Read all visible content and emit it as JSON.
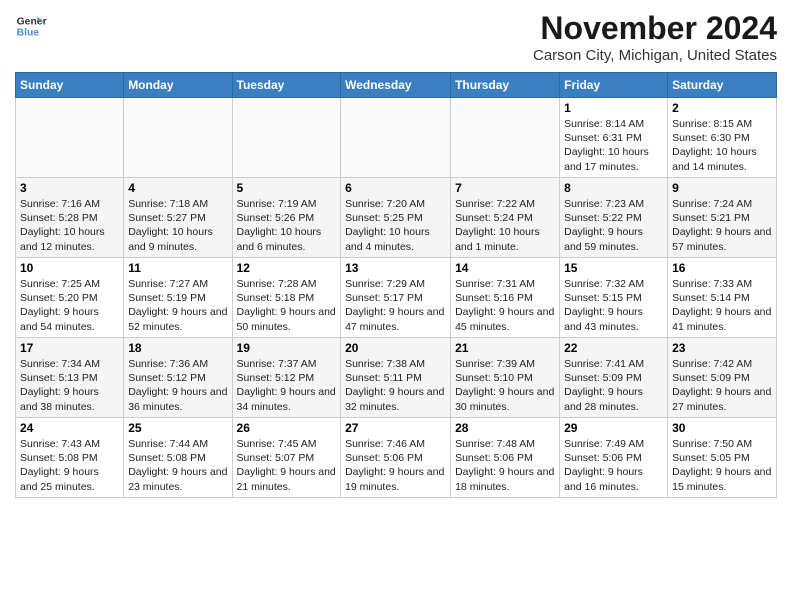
{
  "header": {
    "logo_line1": "General",
    "logo_line2": "Blue",
    "month_title": "November 2024",
    "location": "Carson City, Michigan, United States"
  },
  "weekdays": [
    "Sunday",
    "Monday",
    "Tuesday",
    "Wednesday",
    "Thursday",
    "Friday",
    "Saturday"
  ],
  "weeks": [
    [
      {
        "day": "",
        "info": ""
      },
      {
        "day": "",
        "info": ""
      },
      {
        "day": "",
        "info": ""
      },
      {
        "day": "",
        "info": ""
      },
      {
        "day": "",
        "info": ""
      },
      {
        "day": "1",
        "info": "Sunrise: 8:14 AM\nSunset: 6:31 PM\nDaylight: 10 hours and 17 minutes."
      },
      {
        "day": "2",
        "info": "Sunrise: 8:15 AM\nSunset: 6:30 PM\nDaylight: 10 hours and 14 minutes."
      }
    ],
    [
      {
        "day": "3",
        "info": "Sunrise: 7:16 AM\nSunset: 5:28 PM\nDaylight: 10 hours and 12 minutes."
      },
      {
        "day": "4",
        "info": "Sunrise: 7:18 AM\nSunset: 5:27 PM\nDaylight: 10 hours and 9 minutes."
      },
      {
        "day": "5",
        "info": "Sunrise: 7:19 AM\nSunset: 5:26 PM\nDaylight: 10 hours and 6 minutes."
      },
      {
        "day": "6",
        "info": "Sunrise: 7:20 AM\nSunset: 5:25 PM\nDaylight: 10 hours and 4 minutes."
      },
      {
        "day": "7",
        "info": "Sunrise: 7:22 AM\nSunset: 5:24 PM\nDaylight: 10 hours and 1 minute."
      },
      {
        "day": "8",
        "info": "Sunrise: 7:23 AM\nSunset: 5:22 PM\nDaylight: 9 hours and 59 minutes."
      },
      {
        "day": "9",
        "info": "Sunrise: 7:24 AM\nSunset: 5:21 PM\nDaylight: 9 hours and 57 minutes."
      }
    ],
    [
      {
        "day": "10",
        "info": "Sunrise: 7:25 AM\nSunset: 5:20 PM\nDaylight: 9 hours and 54 minutes."
      },
      {
        "day": "11",
        "info": "Sunrise: 7:27 AM\nSunset: 5:19 PM\nDaylight: 9 hours and 52 minutes."
      },
      {
        "day": "12",
        "info": "Sunrise: 7:28 AM\nSunset: 5:18 PM\nDaylight: 9 hours and 50 minutes."
      },
      {
        "day": "13",
        "info": "Sunrise: 7:29 AM\nSunset: 5:17 PM\nDaylight: 9 hours and 47 minutes."
      },
      {
        "day": "14",
        "info": "Sunrise: 7:31 AM\nSunset: 5:16 PM\nDaylight: 9 hours and 45 minutes."
      },
      {
        "day": "15",
        "info": "Sunrise: 7:32 AM\nSunset: 5:15 PM\nDaylight: 9 hours and 43 minutes."
      },
      {
        "day": "16",
        "info": "Sunrise: 7:33 AM\nSunset: 5:14 PM\nDaylight: 9 hours and 41 minutes."
      }
    ],
    [
      {
        "day": "17",
        "info": "Sunrise: 7:34 AM\nSunset: 5:13 PM\nDaylight: 9 hours and 38 minutes."
      },
      {
        "day": "18",
        "info": "Sunrise: 7:36 AM\nSunset: 5:12 PM\nDaylight: 9 hours and 36 minutes."
      },
      {
        "day": "19",
        "info": "Sunrise: 7:37 AM\nSunset: 5:12 PM\nDaylight: 9 hours and 34 minutes."
      },
      {
        "day": "20",
        "info": "Sunrise: 7:38 AM\nSunset: 5:11 PM\nDaylight: 9 hours and 32 minutes."
      },
      {
        "day": "21",
        "info": "Sunrise: 7:39 AM\nSunset: 5:10 PM\nDaylight: 9 hours and 30 minutes."
      },
      {
        "day": "22",
        "info": "Sunrise: 7:41 AM\nSunset: 5:09 PM\nDaylight: 9 hours and 28 minutes."
      },
      {
        "day": "23",
        "info": "Sunrise: 7:42 AM\nSunset: 5:09 PM\nDaylight: 9 hours and 27 minutes."
      }
    ],
    [
      {
        "day": "24",
        "info": "Sunrise: 7:43 AM\nSunset: 5:08 PM\nDaylight: 9 hours and 25 minutes."
      },
      {
        "day": "25",
        "info": "Sunrise: 7:44 AM\nSunset: 5:08 PM\nDaylight: 9 hours and 23 minutes."
      },
      {
        "day": "26",
        "info": "Sunrise: 7:45 AM\nSunset: 5:07 PM\nDaylight: 9 hours and 21 minutes."
      },
      {
        "day": "27",
        "info": "Sunrise: 7:46 AM\nSunset: 5:06 PM\nDaylight: 9 hours and 19 minutes."
      },
      {
        "day": "28",
        "info": "Sunrise: 7:48 AM\nSunset: 5:06 PM\nDaylight: 9 hours and 18 minutes."
      },
      {
        "day": "29",
        "info": "Sunrise: 7:49 AM\nSunset: 5:06 PM\nDaylight: 9 hours and 16 minutes."
      },
      {
        "day": "30",
        "info": "Sunrise: 7:50 AM\nSunset: 5:05 PM\nDaylight: 9 hours and 15 minutes."
      }
    ]
  ]
}
